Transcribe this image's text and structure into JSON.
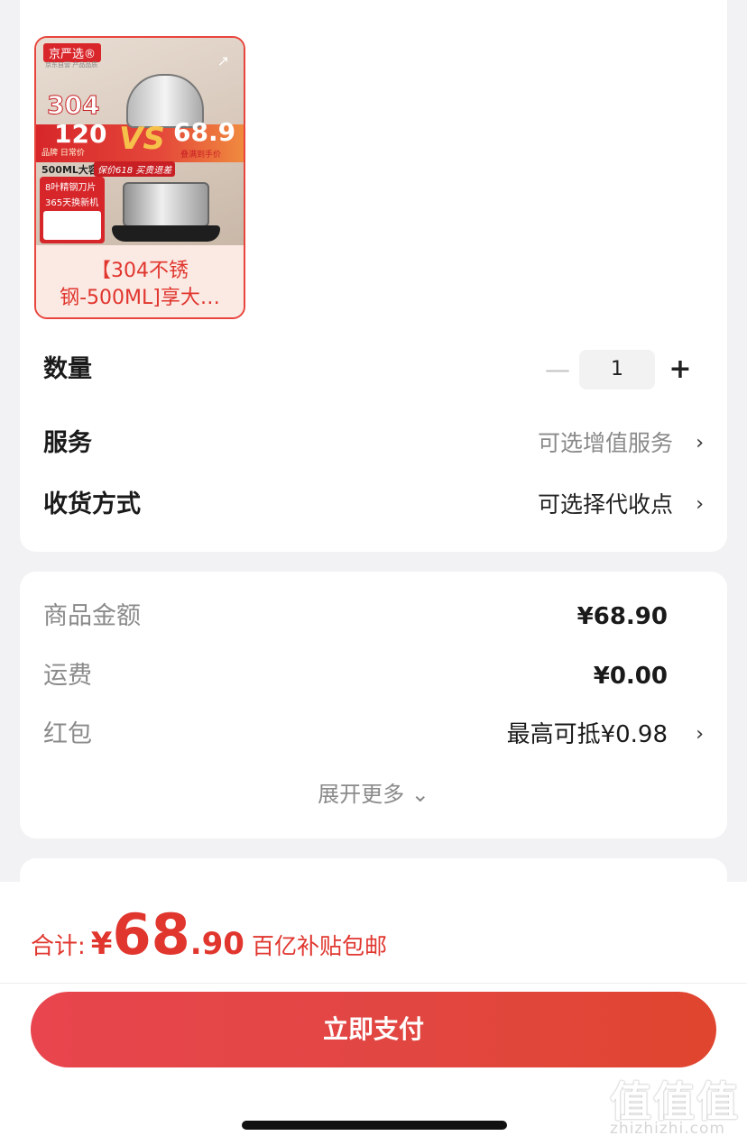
{
  "product": {
    "brand_badge": "京严选®",
    "brand_sub": "京东自营 产品品质",
    "image_text": {
      "big_304": "304",
      "big_120": "120",
      "vs": "VS",
      "big_price": "68.9",
      "left_small": "品牌 日常价",
      "right_small": "叠满到手价",
      "capacity": "500ML大容",
      "promo": "保价618 买贵退差",
      "feature_1": "8叶精钢刀片",
      "feature_2": "365天换新机"
    },
    "title": "【304不锈钢-500ML]享大…"
  },
  "options": {
    "quantity_label": "数量",
    "quantity_value": "1",
    "minus_label": "—",
    "plus_label": "+",
    "service_label": "服务",
    "service_value": "可选增值服务",
    "delivery_label": "收货方式",
    "delivery_value": "可选择代收点"
  },
  "fees": {
    "goods_amount_label": "商品金额",
    "goods_amount_value": "¥68.90",
    "shipping_label": "运费",
    "shipping_value": "¥0.00",
    "red_packet_label": "红包",
    "red_packet_value": "最高可抵¥0.98",
    "expand_label": "展开更多",
    "expand_icon": "⌄"
  },
  "checkout": {
    "total_label": "合计:",
    "total_yen": "¥",
    "total_int": "68",
    "total_dec": ".90",
    "subsidy_note": "百亿补贴包邮",
    "pay_button": "立即支付"
  },
  "chevron": "›",
  "watermark": {
    "logo": "值值值",
    "site": "zhizhizhi.com"
  },
  "colors": {
    "accent_red": "#e0362e",
    "page_bg": "#f2f2f4"
  }
}
